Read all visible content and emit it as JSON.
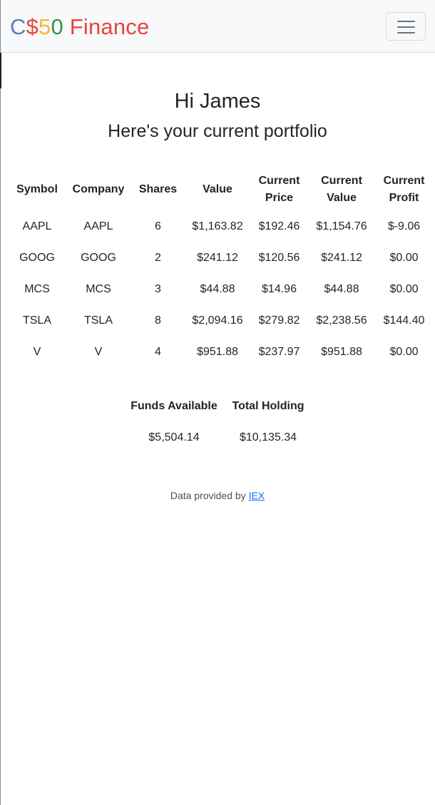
{
  "brand": {
    "parts": [
      {
        "text": "C",
        "color": "#537fbe"
      },
      {
        "text": "$",
        "color": "#ea433b"
      },
      {
        "text": "5",
        "color": "#f5b82e"
      },
      {
        "text": "0",
        "color": "#2e944b"
      },
      {
        "text": " Finance",
        "color": "#ea433b"
      }
    ]
  },
  "greeting": {
    "title": "Hi James",
    "subtitle": "Here's your current portfolio"
  },
  "portfolio": {
    "headers": [
      "Symbol",
      "Company",
      "Shares",
      "Value",
      "Current Price",
      "Current Value",
      "Current Profit"
    ],
    "rows": [
      [
        "AAPL",
        "AAPL",
        "6",
        "$1,163.82",
        "$192.46",
        "$1,154.76",
        "$-9.06"
      ],
      [
        "GOOG",
        "GOOG",
        "2",
        "$241.12",
        "$120.56",
        "$241.12",
        "$0.00"
      ],
      [
        "MCS",
        "MCS",
        "3",
        "$44.88",
        "$14.96",
        "$44.88",
        "$0.00"
      ],
      [
        "TSLA",
        "TSLA",
        "8",
        "$2,094.16",
        "$279.82",
        "$2,238.56",
        "$144.40"
      ],
      [
        "V",
        "V",
        "4",
        "$951.88",
        "$237.97",
        "$951.88",
        "$0.00"
      ]
    ]
  },
  "totals": {
    "headers": [
      "Funds Available",
      "Total Holding"
    ],
    "values": [
      "$5,504.14",
      "$10,135.34"
    ]
  },
  "footer": {
    "text": "Data provided by",
    "link_label": "IEX"
  }
}
